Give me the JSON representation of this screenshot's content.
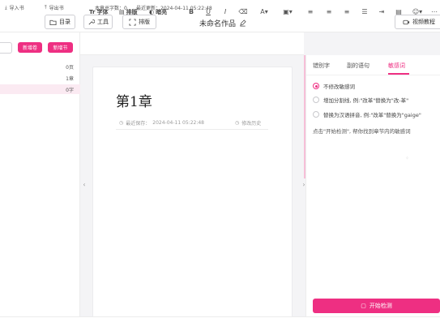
{
  "toolbar": {
    "catalog_label": "目录",
    "tools_label": "工具",
    "typeset_label": "排版",
    "video_tutorial_label": "视频教程"
  },
  "document": {
    "title": "未命名作品"
  },
  "sidebar": {
    "new_volume_label": "新增卷",
    "new_chapter_label": "新增节",
    "rows": [
      {
        "count": "0页"
      },
      {
        "count": "1章"
      },
      {
        "count": "0字"
      }
    ]
  },
  "format_toolbar": {
    "font_label": "字体",
    "layout_label": "排版",
    "theme_label": "暗亮"
  },
  "editor": {
    "chapter_title": "第1章",
    "last_saved_label": "最近保存：",
    "last_saved_time": "2024-04-11 05:22:48",
    "history_label": "修改历史"
  },
  "right_panel": {
    "tabs": [
      {
        "label": "错别字"
      },
      {
        "label": "副的语句"
      },
      {
        "label": "敏感词"
      }
    ],
    "options": [
      {
        "label": "不修改敏感词",
        "checked": true
      },
      {
        "label": "增加分割线, 例:\"改革\"替换为\"改-革\"",
        "checked": false
      },
      {
        "label": "替换为汉语拼音, 例:\"改革\"替换为\"gaige\"",
        "checked": false
      }
    ],
    "hint": "点击\"开始检测\", 帮你找到章节内的敏感词",
    "detect_button_label": "开始检测"
  },
  "status_bar": {
    "import_label": "导入书",
    "export_label": "导出书",
    "word_count": "本章总字数：0",
    "last_update": "最近更新：2024-04-11 05:22:48"
  },
  "colors": {
    "accent": "#ee2f82",
    "accent_light": "#fbeaf2"
  }
}
